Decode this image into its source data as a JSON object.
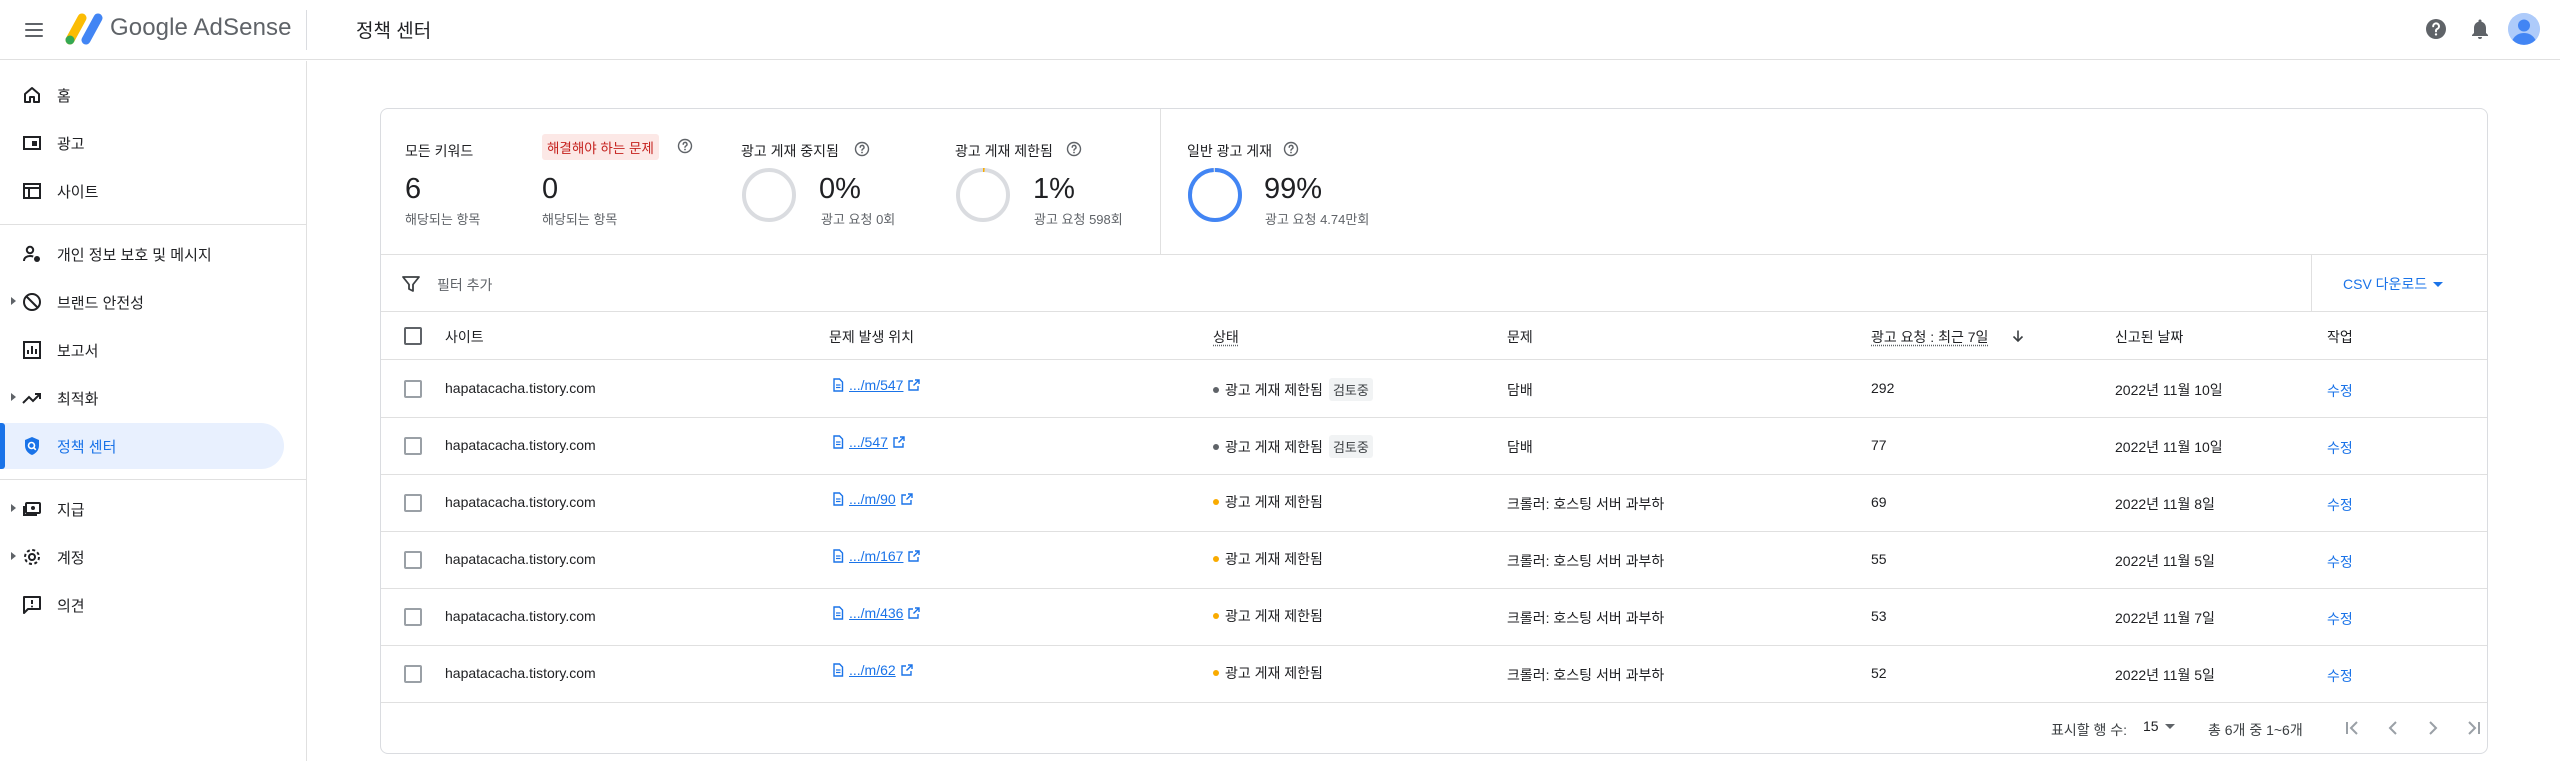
{
  "app": {
    "brand_google": "Google",
    "brand_product": "AdSense",
    "page_title": "정책 센터"
  },
  "sidebar": {
    "items": [
      {
        "label": "홈",
        "icon": "home-icon"
      },
      {
        "label": "광고",
        "icon": "ads-icon"
      },
      {
        "label": "사이트",
        "icon": "sites-icon"
      },
      {
        "label": "개인 정보 보호 및 메시지",
        "icon": "privacy-messaging-icon"
      },
      {
        "label": "브랜드 안전성",
        "icon": "block-icon"
      },
      {
        "label": "보고서",
        "icon": "reports-icon"
      },
      {
        "label": "최적화",
        "icon": "trending-up-icon"
      },
      {
        "label": "정책 센터",
        "icon": "policy-shield-icon"
      },
      {
        "label": "지급",
        "icon": "payments-icon"
      },
      {
        "label": "계정",
        "icon": "gear-icon"
      },
      {
        "label": "의견",
        "icon": "feedback-icon"
      }
    ]
  },
  "summary": {
    "all_sites": {
      "label": "모든 키워드",
      "value": "6",
      "sub": "해당되는 항목"
    },
    "must_fix": {
      "label": "해결해야 하는 문제",
      "value": "0",
      "sub": "해당되는 항목"
    },
    "disabled": {
      "label": "광고 게재 중지됨",
      "value": "0%",
      "sub": "광고 요청 0회",
      "fraction": 0
    },
    "restricted": {
      "label": "광고 게재 제한됨",
      "value": "1%",
      "sub": "광고 요청 598회",
      "fraction": 0.01
    },
    "normal": {
      "label": "일반 광고 게재",
      "value": "99%",
      "sub": "광고 요청 4.74만회",
      "fraction": 0.99
    }
  },
  "filter": {
    "placeholder": "필터 추가",
    "csv_label": "CSV 다운로드"
  },
  "table": {
    "headers": {
      "site": "사이트",
      "location": "문제 발생 위치",
      "status": "상태",
      "issue": "문제",
      "requests": "광고 요청 : 최근 7일",
      "reported": "신고된 날짜",
      "action": "작업"
    },
    "rows": [
      {
        "site": "hapatacacha.tistory.com",
        "location": ".../m/547",
        "status": "광고 게재 제한됨",
        "review": "검토중",
        "issue": "담배",
        "requests": "292",
        "reported": "2022년 11월 10일",
        "action": "수정"
      },
      {
        "site": "hapatacacha.tistory.com",
        "location": ".../547",
        "status": "광고 게재 제한됨",
        "review": "검토중",
        "issue": "담배",
        "requests": "77",
        "reported": "2022년 11월 10일",
        "action": "수정"
      },
      {
        "site": "hapatacacha.tistory.com",
        "location": ".../m/90",
        "status": "광고 게재 제한됨",
        "review": "",
        "issue": "크롤러: 호스팅 서버 과부하",
        "requests": "69",
        "reported": "2022년 11월 8일",
        "action": "수정"
      },
      {
        "site": "hapatacacha.tistory.com",
        "location": ".../m/167",
        "status": "광고 게재 제한됨",
        "review": "",
        "issue": "크롤러: 호스팅 서버 과부하",
        "requests": "55",
        "reported": "2022년 11월 5일",
        "action": "수정"
      },
      {
        "site": "hapatacacha.tistory.com",
        "location": ".../m/436",
        "status": "광고 게재 제한됨",
        "review": "",
        "issue": "크롤러: 호스팅 서버 과부하",
        "requests": "53",
        "reported": "2022년 11월 7일",
        "action": "수정"
      },
      {
        "site": "hapatacacha.tistory.com",
        "location": ".../m/62",
        "status": "광고 게재 제한됨",
        "review": "",
        "issue": "크롤러: 호스팅 서버 과부하",
        "requests": "52",
        "reported": "2022년 11월 5일",
        "action": "수정"
      }
    ]
  },
  "pagination": {
    "rows_label": "표시할 행 수:",
    "rows_value": "15",
    "range": "총 6개 중 1~6개"
  },
  "colors": {
    "accent": "#1a73e8",
    "review_dot": "#5f6368",
    "warning_dot": "#f9ab00",
    "error_bg": "#fce8e6",
    "error_text": "#c5221f"
  }
}
